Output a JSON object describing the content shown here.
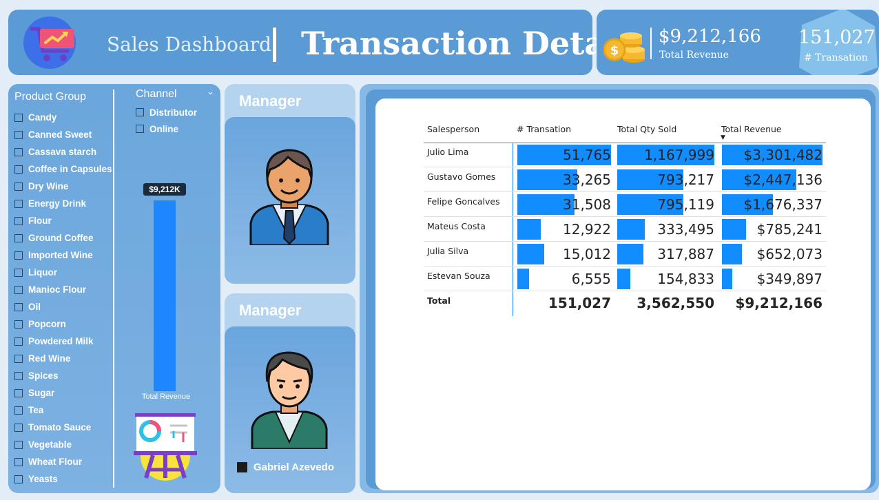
{
  "header": {
    "subtitle": "Sales Dashboard",
    "title": "Transaction Details"
  },
  "kpis": {
    "total_revenue_value": "$9,212,166",
    "total_revenue_label": "Total Revenue",
    "transactions_value": "151,027",
    "transactions_label": "# Transation"
  },
  "filters": {
    "product_group": {
      "title": "Product Group",
      "items": [
        "Candy",
        "Canned Sweet",
        "Cassava starch",
        "Coffee in Capsules",
        "Dry Wine",
        "Energy Drink",
        "Flour",
        "Ground Coffee",
        "Imported Wine",
        "Liquor",
        "Manioc Flour",
        "Oil",
        "Popcorn",
        "Powdered Milk",
        "Red Wine",
        "Spices",
        "Sugar",
        "Tea",
        "Tomato Sauce",
        "Vegetable",
        "Wheat Flour",
        "Yeasts"
      ]
    },
    "channel": {
      "title": "Channel",
      "items": [
        "Distributor",
        "Online"
      ]
    },
    "bar": {
      "value_label": "$9,212K",
      "axis_label": "Total Revenue"
    }
  },
  "managers": [
    {
      "title": "Manager"
    },
    {
      "title": "Manager",
      "legend_name": "Gabriel Azevedo"
    }
  ],
  "table": {
    "columns": [
      "Salesperson",
      "# Transation",
      "Total Qty Sold",
      "Total Revenue"
    ],
    "rows": [
      {
        "name": "Julio Lima",
        "transactions": "51,765",
        "qty": "1,167,999",
        "revenue": "$3,301,482"
      },
      {
        "name": "Gustavo Gomes",
        "transactions": "33,265",
        "qty": "793,217",
        "revenue": "$2,447,136"
      },
      {
        "name": "Felipe Goncalves",
        "transactions": "31,508",
        "qty": "795,119",
        "revenue": "$1,676,337"
      },
      {
        "name": "Mateus Costa",
        "transactions": "12,922",
        "qty": "333,495",
        "revenue": "$785,241"
      },
      {
        "name": "Julia Silva",
        "transactions": "15,012",
        "qty": "317,887",
        "revenue": "$652,073"
      },
      {
        "name": "Estevan Souza",
        "transactions": "6,555",
        "qty": "154,833",
        "revenue": "$349,897"
      }
    ],
    "total": {
      "label": "Total",
      "transactions": "151,027",
      "qty": "3,562,550",
      "revenue": "$9,212,166"
    }
  },
  "colors": {
    "panel_blue": "#5b9bd5",
    "bar_blue": "#118dff"
  }
}
